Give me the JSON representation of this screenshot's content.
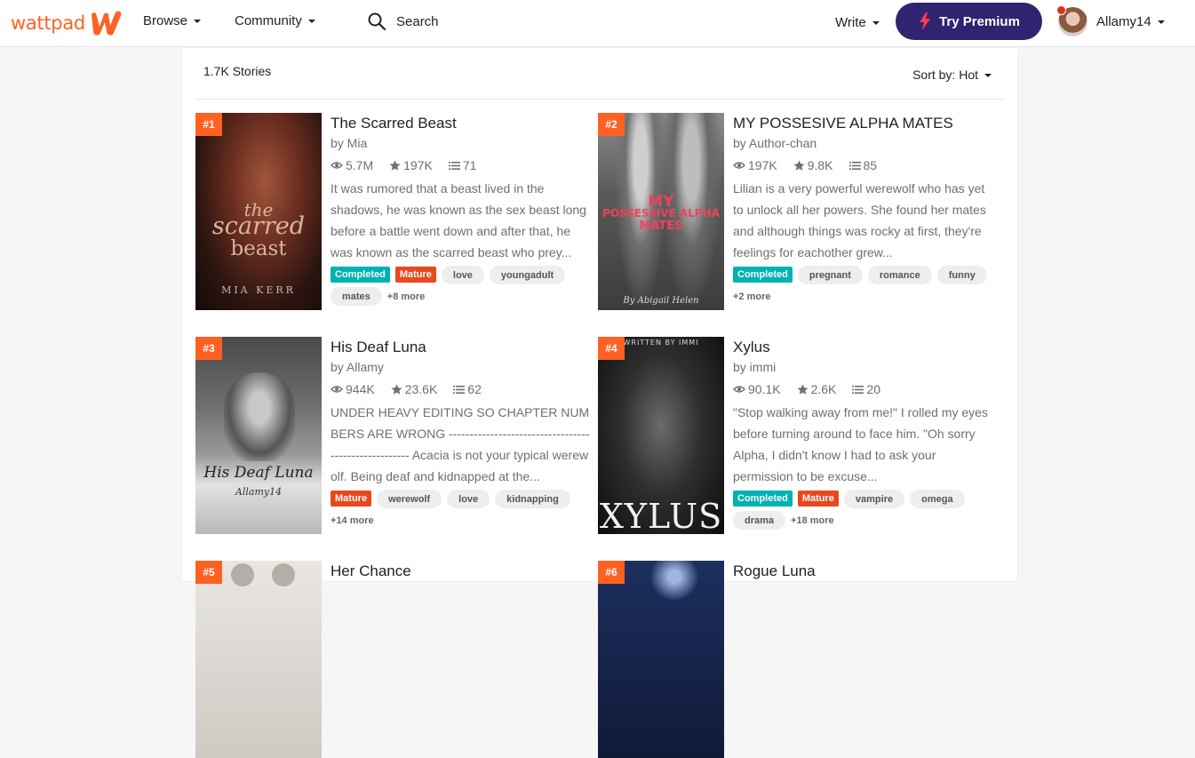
{
  "header": {
    "logo_text": "wattpad",
    "nav": {
      "browse": "Browse",
      "community": "Community"
    },
    "search_label": "Search",
    "write": "Write",
    "premium": "Try Premium",
    "username": "Allamy14",
    "brand_color": "#ff6122",
    "premium_color": "#2e2470"
  },
  "panel": {
    "story_count": "1.7K Stories",
    "sort_label": "Sort by: Hot"
  },
  "stories": [
    {
      "rank": "#1",
      "title": "The Scarred Beast",
      "author": "by Mia",
      "reads": "5.7M",
      "votes": "197K",
      "parts": "71",
      "description": "It was rumored that a beast lived in the shadows, he was known as the sex beast long before a battle went down and after that, he was known as the scarred beast who prey...",
      "tags": [
        "Completed",
        "Mature",
        "love",
        "youngadult",
        "mates"
      ],
      "more": "+8 more",
      "cover_text": [
        "the",
        "scarred",
        "beast",
        "MIA KERR"
      ]
    },
    {
      "rank": "#2",
      "title": "MY POSSESIVE ALPHA MATES",
      "author": "by Author-chan",
      "reads": "197K",
      "votes": "9.8K",
      "parts": "85",
      "description": "Lilian is a very powerful werewolf who has yet to unlock all her powers. She found her mates and although things was rocky at first, they're feelings for eachother grew...",
      "tags": [
        "Completed",
        "pregnant",
        "romance",
        "funny"
      ],
      "more": "+2 more",
      "cover_text": [
        "MY",
        "POSSESSIVE ALPHA",
        "MATES",
        "By Abigail Helen"
      ]
    },
    {
      "rank": "#3",
      "title": "His Deaf Luna",
      "author": "by Allamy",
      "reads": "944K",
      "votes": "23.6K",
      "parts": "62",
      "description": "UNDER HEAVY EDITING SO CHAPTER NUMBERS ARE WRONG ----------------------------------------------------- Acacia is not your typical werewolf. Being deaf and kidnapped at the...",
      "tags": [
        "Mature",
        "werewolf",
        "love",
        "kidnapping"
      ],
      "more": "+14 more",
      "cover_text": [
        "His Deaf Luna",
        "Allamy14"
      ]
    },
    {
      "rank": "#4",
      "title": "Xylus",
      "author": "by immi",
      "reads": "90.1K",
      "votes": "2.6K",
      "parts": "20",
      "description": "\"Stop walking away from me!\" I rolled my eyes before turning around to face him. \"Oh sorry Alpha, I didn't know I had to ask your permission to be excuse...",
      "tags": [
        "Completed",
        "Mature",
        "vampire",
        "omega",
        "drama"
      ],
      "more": "+18 more",
      "cover_text": [
        "WRITTEN BY IMMI",
        "XYLUS"
      ]
    },
    {
      "rank": "#5",
      "title": "Her Chance"
    },
    {
      "rank": "#6",
      "title": "Rogue Luna"
    }
  ]
}
